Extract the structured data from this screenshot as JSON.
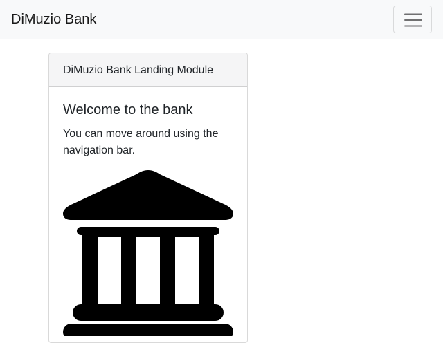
{
  "navbar": {
    "brand": "DiMuzio Bank",
    "toggle_icon": "hamburger-menu-icon"
  },
  "card": {
    "header": "DiMuzio Bank Landing Module",
    "title": "Welcome to the bank",
    "text": "You can move around using the navigation bar.",
    "image_icon": "bank-building-icon"
  }
}
